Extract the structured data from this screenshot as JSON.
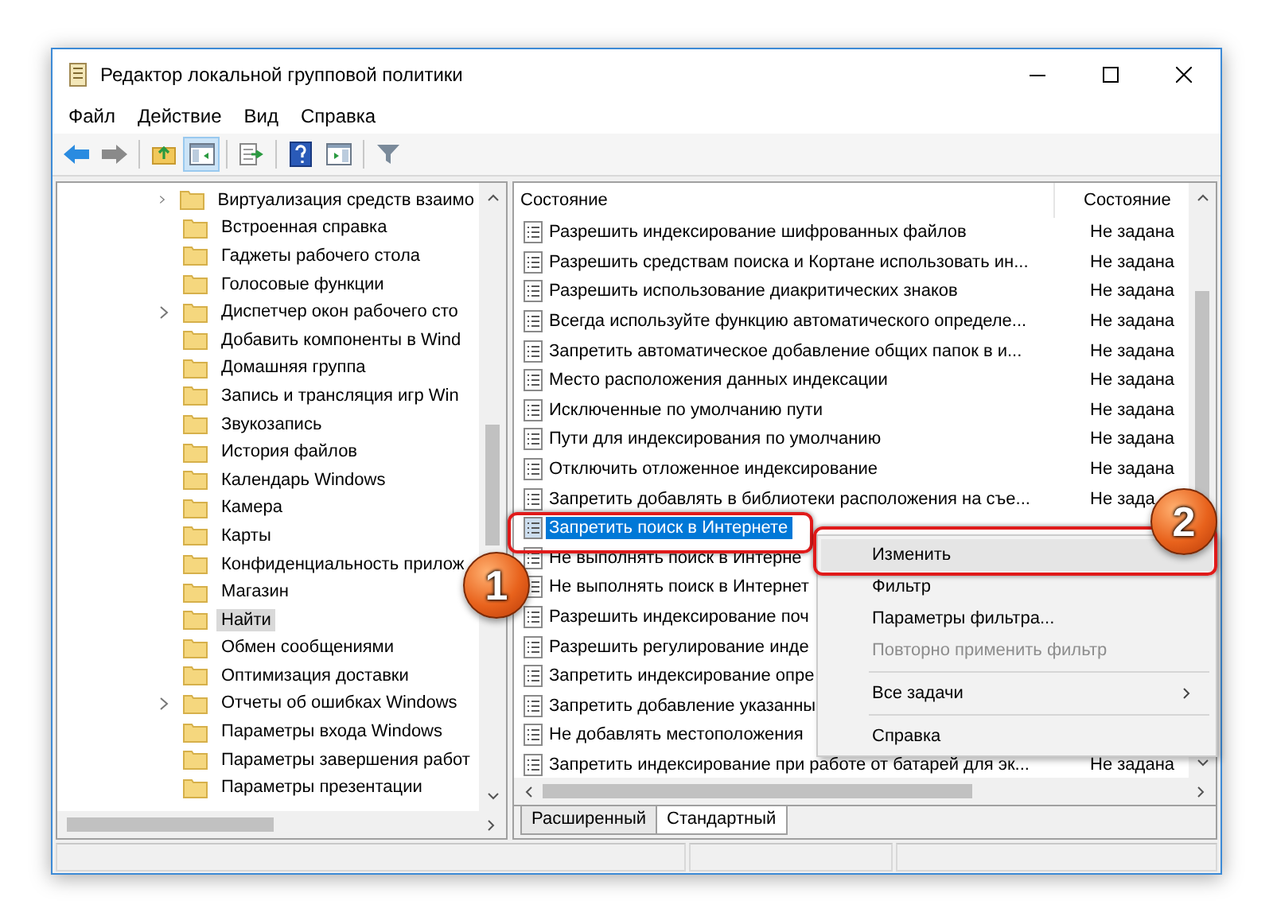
{
  "window": {
    "title": "Редактор локальной групповой политики"
  },
  "menu": [
    "Файл",
    "Действие",
    "Вид",
    "Справка"
  ],
  "toolbar": [
    {
      "kind": "back",
      "pressed": false
    },
    {
      "kind": "forward",
      "pressed": false
    },
    {
      "kind": "sep"
    },
    {
      "kind": "up",
      "pressed": false
    },
    {
      "kind": "tree",
      "pressed": true
    },
    {
      "kind": "sep"
    },
    {
      "kind": "export",
      "pressed": false
    },
    {
      "kind": "sep"
    },
    {
      "kind": "help",
      "pressed": false
    },
    {
      "kind": "pane",
      "pressed": false
    },
    {
      "kind": "sep"
    },
    {
      "kind": "filter",
      "pressed": false
    }
  ],
  "tree": [
    {
      "label": "Виртуализация средств взаимо",
      "expandable": true,
      "selected": false
    },
    {
      "label": "Встроенная справка",
      "expandable": false,
      "selected": false
    },
    {
      "label": "Гаджеты рабочего стола",
      "expandable": false,
      "selected": false
    },
    {
      "label": "Голосовые функции",
      "expandable": false,
      "selected": false
    },
    {
      "label": "Диспетчер окон рабочего сто",
      "expandable": true,
      "selected": false
    },
    {
      "label": "Добавить компоненты в Wind",
      "expandable": false,
      "selected": false
    },
    {
      "label": "Домашняя группа",
      "expandable": false,
      "selected": false
    },
    {
      "label": "Запись и трансляция игр Win",
      "expandable": false,
      "selected": false
    },
    {
      "label": "Звукозапись",
      "expandable": false,
      "selected": false
    },
    {
      "label": "История файлов",
      "expandable": false,
      "selected": false
    },
    {
      "label": "Календарь Windows",
      "expandable": false,
      "selected": false
    },
    {
      "label": "Камера",
      "expandable": false,
      "selected": false
    },
    {
      "label": "Карты",
      "expandable": false,
      "selected": false
    },
    {
      "label": "Конфиденциальность прилож",
      "expandable": false,
      "selected": false
    },
    {
      "label": "Магазин",
      "expandable": false,
      "selected": false
    },
    {
      "label": "Найти",
      "expandable": false,
      "selected": true
    },
    {
      "label": "Обмен сообщениями",
      "expandable": false,
      "selected": false
    },
    {
      "label": "Оптимизация доставки",
      "expandable": false,
      "selected": false
    },
    {
      "label": "Отчеты об ошибках Windows",
      "expandable": true,
      "selected": false
    },
    {
      "label": "Параметры входа Windows",
      "expandable": false,
      "selected": false
    },
    {
      "label": "Параметры завершения работ",
      "expandable": false,
      "selected": false
    },
    {
      "label": "Параметры презентации",
      "expandable": false,
      "selected": false
    }
  ],
  "table": {
    "columns": [
      "Состояние",
      "Состояние"
    ],
    "rows": [
      {
        "name": "Разрешить индексирование шифрованных файлов",
        "state": "Не задана",
        "selected": false
      },
      {
        "name": "Разрешить средствам поиска и Кортане использовать ин...",
        "state": "Не задана",
        "selected": false
      },
      {
        "name": "Разрешить использование диакритических знаков",
        "state": "Не задана",
        "selected": false
      },
      {
        "name": "Всегда используйте функцию автоматического определе...",
        "state": "Не задана",
        "selected": false
      },
      {
        "name": "Запретить автоматическое добавление общих папок в и...",
        "state": "Не задана",
        "selected": false
      },
      {
        "name": "Место расположения данных индексации",
        "state": "Не задана",
        "selected": false
      },
      {
        "name": "Исключенные по умолчанию пути",
        "state": "Не задана",
        "selected": false
      },
      {
        "name": "Пути для индексирования по умолчанию",
        "state": "Не задана",
        "selected": false
      },
      {
        "name": "Отключить отложенное индексирование",
        "state": "Не задана",
        "selected": false
      },
      {
        "name": "Запретить добавлять в библиотеки расположения на съе...",
        "state": "Не зада",
        "selected": false
      },
      {
        "name": "Запретить поиск в Интернете",
        "selected": true
      },
      {
        "name": "Не выполнять поиск в Интерне",
        "selected": false
      },
      {
        "name": "Не выполнять поиск в Интернет",
        "selected": false
      },
      {
        "name": "Разрешить индексирование поч",
        "selected": false
      },
      {
        "name": "Разрешить регулирование инде",
        "selected": false
      },
      {
        "name": "Запретить индексирование опре",
        "selected": false
      },
      {
        "name": "Запретить добавление указанны",
        "selected": false
      },
      {
        "name": "Не добавлять местоположения",
        "selected": false
      },
      {
        "name": "Запретить индексирование при работе от батарей для эк...",
        "state": "Не задана",
        "selected": false
      }
    ]
  },
  "tabs": [
    {
      "label": "Расширенный",
      "selected": false
    },
    {
      "label": "Стандартный",
      "selected": true
    }
  ],
  "context_menu": [
    {
      "kind": "item",
      "label": "Изменить",
      "selected": true,
      "disabled": false
    },
    {
      "kind": "item",
      "label": "Фильтр",
      "selected": false,
      "disabled": false
    },
    {
      "kind": "item",
      "label": "Параметры фильтра...",
      "selected": false,
      "disabled": false
    },
    {
      "kind": "item",
      "label": "Повторно применить фильтр",
      "selected": false,
      "disabled": true
    },
    {
      "kind": "separator"
    },
    {
      "kind": "submenu",
      "label": "Все задачи",
      "selected": false,
      "disabled": false
    },
    {
      "kind": "separator"
    },
    {
      "kind": "item",
      "label": "Справка",
      "selected": false,
      "disabled": false
    }
  ],
  "callouts": [
    {
      "text": "1"
    },
    {
      "text": "2"
    }
  ]
}
